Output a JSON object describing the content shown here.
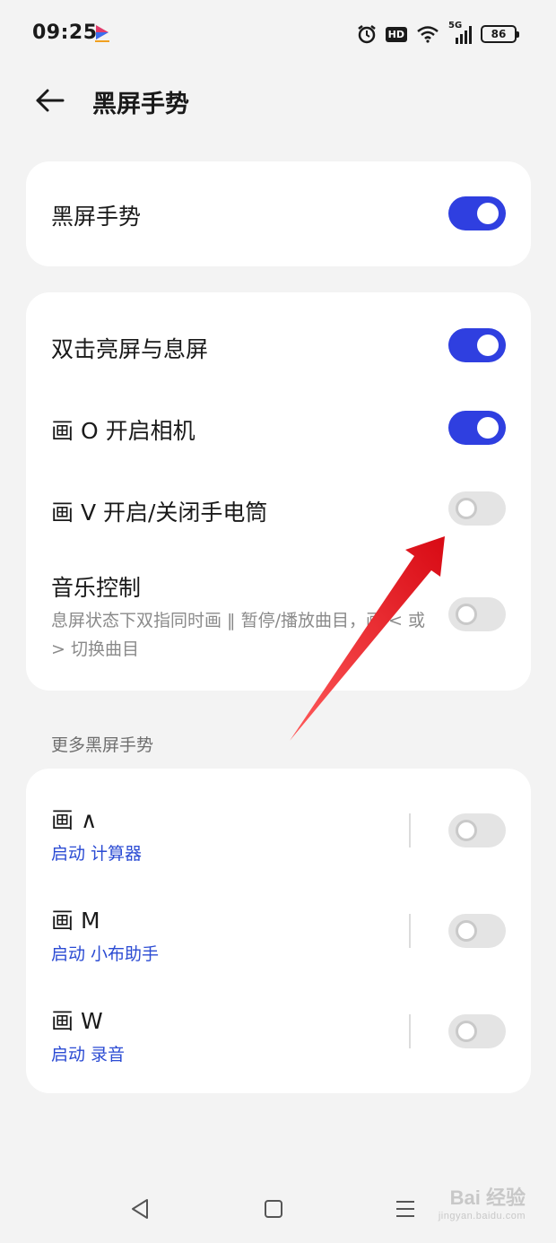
{
  "status_bar": {
    "time": "09:25",
    "network": "5G",
    "battery": "86",
    "icons": [
      "app-logo-icon",
      "alarm-icon",
      "hd-icon",
      "wifi-icon",
      "signal-icon",
      "battery-icon"
    ],
    "hd_label": "HD"
  },
  "header": {
    "title": "黑屏手势",
    "back_icon": "back-arrow-icon"
  },
  "master": {
    "label": "黑屏手势",
    "enabled": true
  },
  "gestures": [
    {
      "label": "双击亮屏与息屏",
      "enabled": true
    },
    {
      "label": "画 O 开启相机",
      "enabled": true
    },
    {
      "label": "画 V 开启/关闭手电筒",
      "enabled": false
    },
    {
      "label": "音乐控制",
      "description": "息屏状态下双指同时画 ‖ 暂停/播放曲目，画 < 或 > 切换曲目",
      "enabled": false
    }
  ],
  "more_section": {
    "title": "更多黑屏手势",
    "items": [
      {
        "label": "画 ∧",
        "action": "启动 计算器",
        "enabled": false
      },
      {
        "label": "画 M",
        "action": "启动 小布助手",
        "enabled": false
      },
      {
        "label": "画 W",
        "action": "启动 录音",
        "enabled": false
      }
    ]
  },
  "nav": {
    "icons": [
      "back-triangle-icon",
      "home-square-icon",
      "recents-menu-icon"
    ]
  },
  "watermark": {
    "main": "Bai 经验",
    "sub": "jingyan.baidu.com"
  },
  "colors": {
    "accent": "#2f3fe0",
    "link": "#2b4bd3",
    "annotation_arrow": "#e8141b",
    "background": "#f3f3f3"
  }
}
